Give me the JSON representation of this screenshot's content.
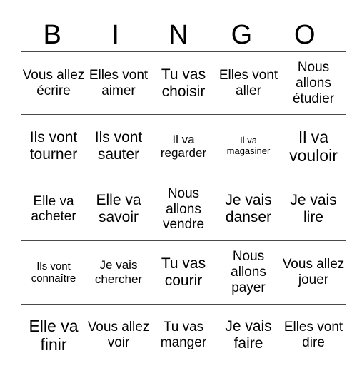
{
  "header": {
    "letters": [
      "B",
      "I",
      "N",
      "G",
      "O"
    ]
  },
  "card": {
    "rows": [
      [
        "Vous allez écrire",
        "Elles vont aimer",
        "Tu vas choisir",
        "Elles vont aller",
        "Nous allons étudier"
      ],
      [
        "Ils vont tourner",
        "Ils vont sauter",
        "Il va regarder",
        "Il va magasiner",
        "Il va vouloir"
      ],
      [
        "Elle va acheter",
        "Elle va savoir",
        "Nous allons vendre",
        "Je vais danser",
        "Je vais lire"
      ],
      [
        "Ils vont connaître",
        "Je vais chercher",
        "Tu vas courir",
        "Nous allons payer",
        "Vous allez jouer"
      ],
      [
        "Elle va finir",
        "Vous allez voir",
        "Tu vas manger",
        "Je vais faire",
        "Elles vont dire"
      ]
    ]
  }
}
